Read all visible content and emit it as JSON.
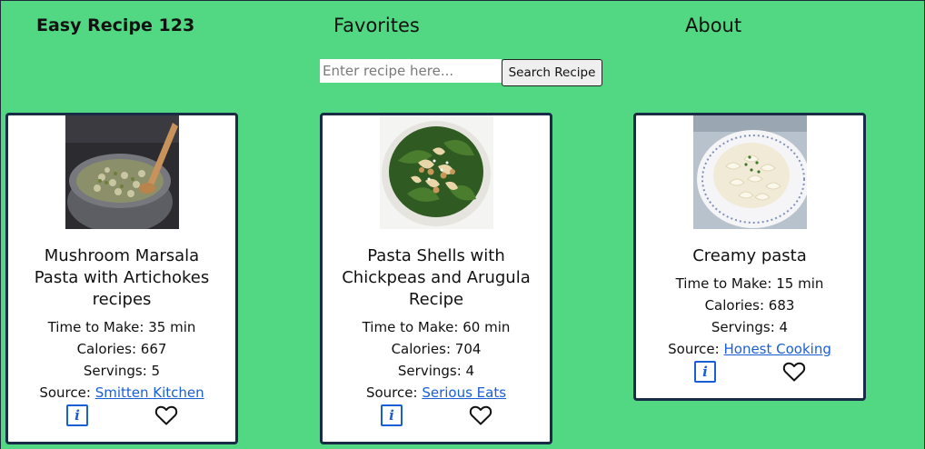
{
  "nav": {
    "brand": "Easy Recipe 123",
    "favorites": "Favorites",
    "about": "About"
  },
  "search": {
    "placeholder": "Enter recipe here...",
    "value": "",
    "button_label": "Search Recipe"
  },
  "recipes": [
    {
      "title": "Mushroom Marsala Pasta with Artichokes recipes",
      "time_label": "Time to Make:",
      "time": "35 min",
      "calories_label": "Calories:",
      "calories": "667",
      "servings_label": "Servings:",
      "servings": "5",
      "source_label": "Source:",
      "source": "Smitten Kitchen",
      "image": "mushroom-pasta-pot-photo"
    },
    {
      "title": "Pasta Shells with Chickpeas and Arugula Recipe",
      "time_label": "Time to Make:",
      "time": "60 min",
      "calories_label": "Calories:",
      "calories": "704",
      "servings_label": "Servings:",
      "servings": "4",
      "source_label": "Source:",
      "source": "Serious Eats",
      "image": "pasta-shells-arugula-photo"
    },
    {
      "title": "Creamy pasta",
      "time_label": "Time to Make:",
      "time": "15 min",
      "calories_label": "Calories:",
      "calories": "683",
      "servings_label": "Servings:",
      "servings": "4",
      "source_label": "Source:",
      "source": "Honest Cooking",
      "image": "creamy-macaroni-plate-photo"
    }
  ],
  "icons": {
    "info": "info-icon",
    "info_glyph": "i",
    "favorite": "heart-outline-icon"
  },
  "colors": {
    "background": "#52d882",
    "card_border": "#1a2b47",
    "link": "#1a5fd6"
  }
}
